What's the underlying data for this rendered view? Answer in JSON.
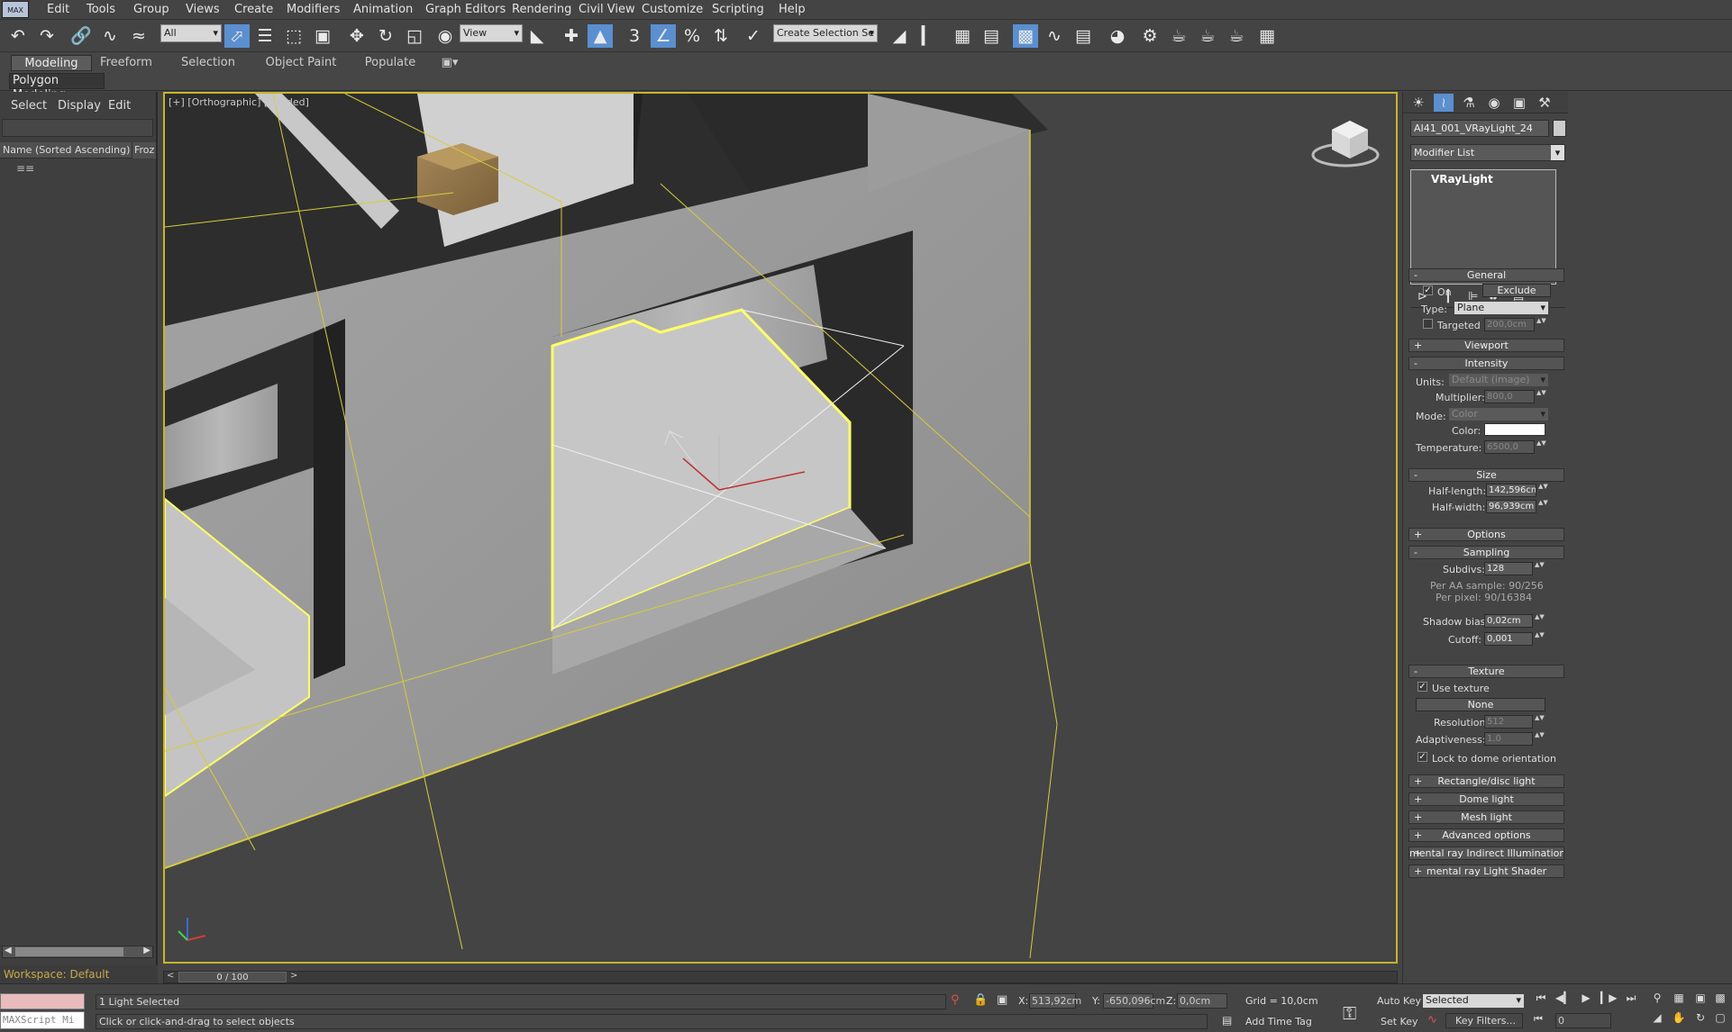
{
  "menu": {
    "logo": "MAX",
    "items": [
      "Edit",
      "Tools",
      "Group",
      "Views",
      "Create",
      "Modifiers",
      "Animation",
      "Graph Editors",
      "Rendering",
      "Civil View",
      "Customize",
      "Scripting",
      "Help"
    ]
  },
  "toolbar": {
    "filter": "All",
    "ref_coord": "View",
    "selection_set": "Create Selection Se",
    "snap_3": "3"
  },
  "ribbon": {
    "tabs": [
      "Modeling",
      "Freeform",
      "Selection",
      "Object Paint",
      "Populate"
    ],
    "active": "Modeling",
    "polygon_modeling": "Polygon Modeling"
  },
  "scene_explorer": {
    "tabs": [
      "Select",
      "Display",
      "Edit"
    ],
    "col_name": "Name (Sorted Ascending)",
    "col_frozen": "Froz",
    "workspace": "Workspace: Default"
  },
  "viewport": {
    "label": "[+] [Orthographic] [Shaded]"
  },
  "command_panel": {
    "object_name": "AI41_001_VRayLight_24",
    "modifier_list": "Modifier List",
    "stack_item": "VRayLight",
    "general": {
      "title": "General",
      "on": "On",
      "exclude": "Exclude",
      "type_label": "Type:",
      "type": "Plane",
      "targeted": "Targeted",
      "targeted_value": "200,0cm"
    },
    "viewport": {
      "title": "Viewport"
    },
    "intensity": {
      "title": "Intensity",
      "units_label": "Units:",
      "units": "Default (image)",
      "multiplier_label": "Multiplier:",
      "multiplier": "800,0",
      "mode_label": "Mode:",
      "mode": "Color",
      "color_label": "Color:",
      "color": "#ffffff",
      "temperature_label": "Temperature:",
      "temperature": "6500,0"
    },
    "size": {
      "title": "Size",
      "half_length_label": "Half-length:",
      "half_length": "142,596cm",
      "half_width_label": "Half-width:",
      "half_width": "96,939cm"
    },
    "options": {
      "title": "Options"
    },
    "sampling": {
      "title": "Sampling",
      "subdivs_label": "Subdivs:",
      "subdivs": "128",
      "per_aa": "Per AA sample: 90/256",
      "per_pixel": "Per pixel: 90/16384",
      "shadow_bias_label": "Shadow bias:",
      "shadow_bias": "0,02cm",
      "cutoff_label": "Cutoff:",
      "cutoff": "0,001"
    },
    "texture": {
      "title": "Texture",
      "use_texture": "Use texture",
      "none": "None",
      "resolution_label": "Resolution:",
      "resolution": "512",
      "adaptiveness_label": "Adaptiveness:",
      "adaptiveness": "1,0",
      "lock_dome": "Lock to dome orientation"
    },
    "rollouts": [
      "Rectangle/disc light",
      "Dome light",
      "Mesh light",
      "Advanced options",
      "mental ray Indirect Illumination",
      "mental ray Light Shader"
    ]
  },
  "timeline": {
    "frame": "0 / 100"
  },
  "status": {
    "maxscript": "MAXScript Mi",
    "selected": "1 Light Selected",
    "prompt": "Click or click-and-drag to select objects",
    "x_label": "X:",
    "x": "513,92cm",
    "y_label": "Y:",
    "y": "-650,096cm",
    "z_label": "Z:",
    "z": "0,0cm",
    "grid": "Grid = 10,0cm",
    "add_time_tag": "Add Time Tag",
    "auto_key": "Auto Key",
    "set_key": "Set Key",
    "key_mode": "Selected",
    "key_filters": "Key Filters...",
    "current_frame": "0"
  }
}
